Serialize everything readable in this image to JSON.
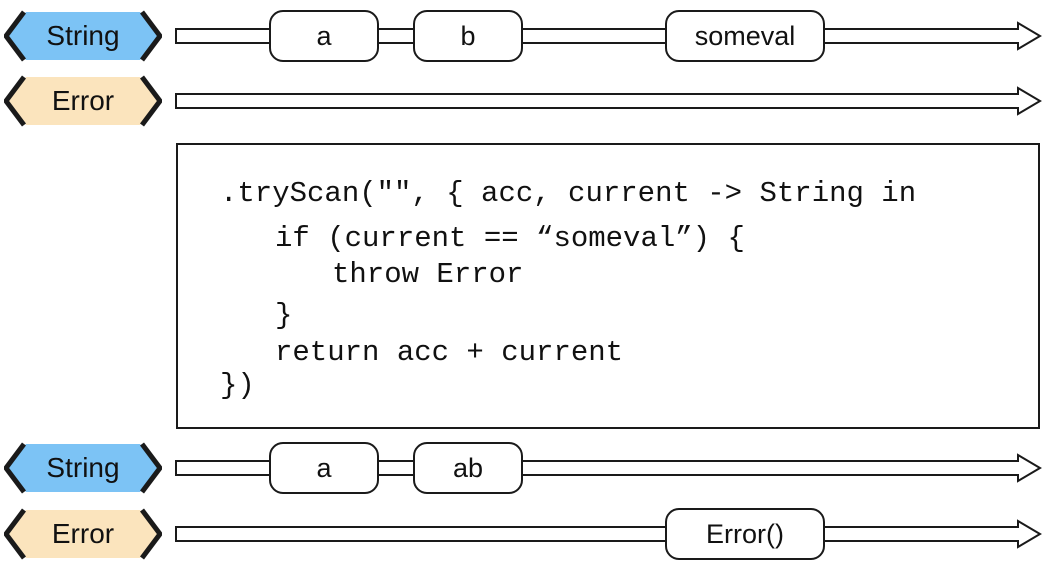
{
  "colors": {
    "string_badge_fill": "#7cc3f5",
    "error_badge_fill": "#fbe4bd",
    "outline": "#1a1a1a",
    "background": "#ffffff"
  },
  "input": {
    "string_lane": {
      "type_label": "String",
      "events": [
        {
          "label": "a"
        },
        {
          "label": "b"
        },
        {
          "label": "someval"
        }
      ]
    },
    "error_lane": {
      "type_label": "Error",
      "events": []
    }
  },
  "operator": {
    "code_lines": [
      ".tryScan(\"\", { acc, current -> String in",
      "if (current == “someval”) {",
      "throw Error",
      "}",
      "return acc + current",
      "})"
    ]
  },
  "output": {
    "string_lane": {
      "type_label": "String",
      "events": [
        {
          "label": "a"
        },
        {
          "label": "ab"
        }
      ]
    },
    "error_lane": {
      "type_label": "Error",
      "events": [
        {
          "label": "Error()"
        }
      ]
    }
  }
}
